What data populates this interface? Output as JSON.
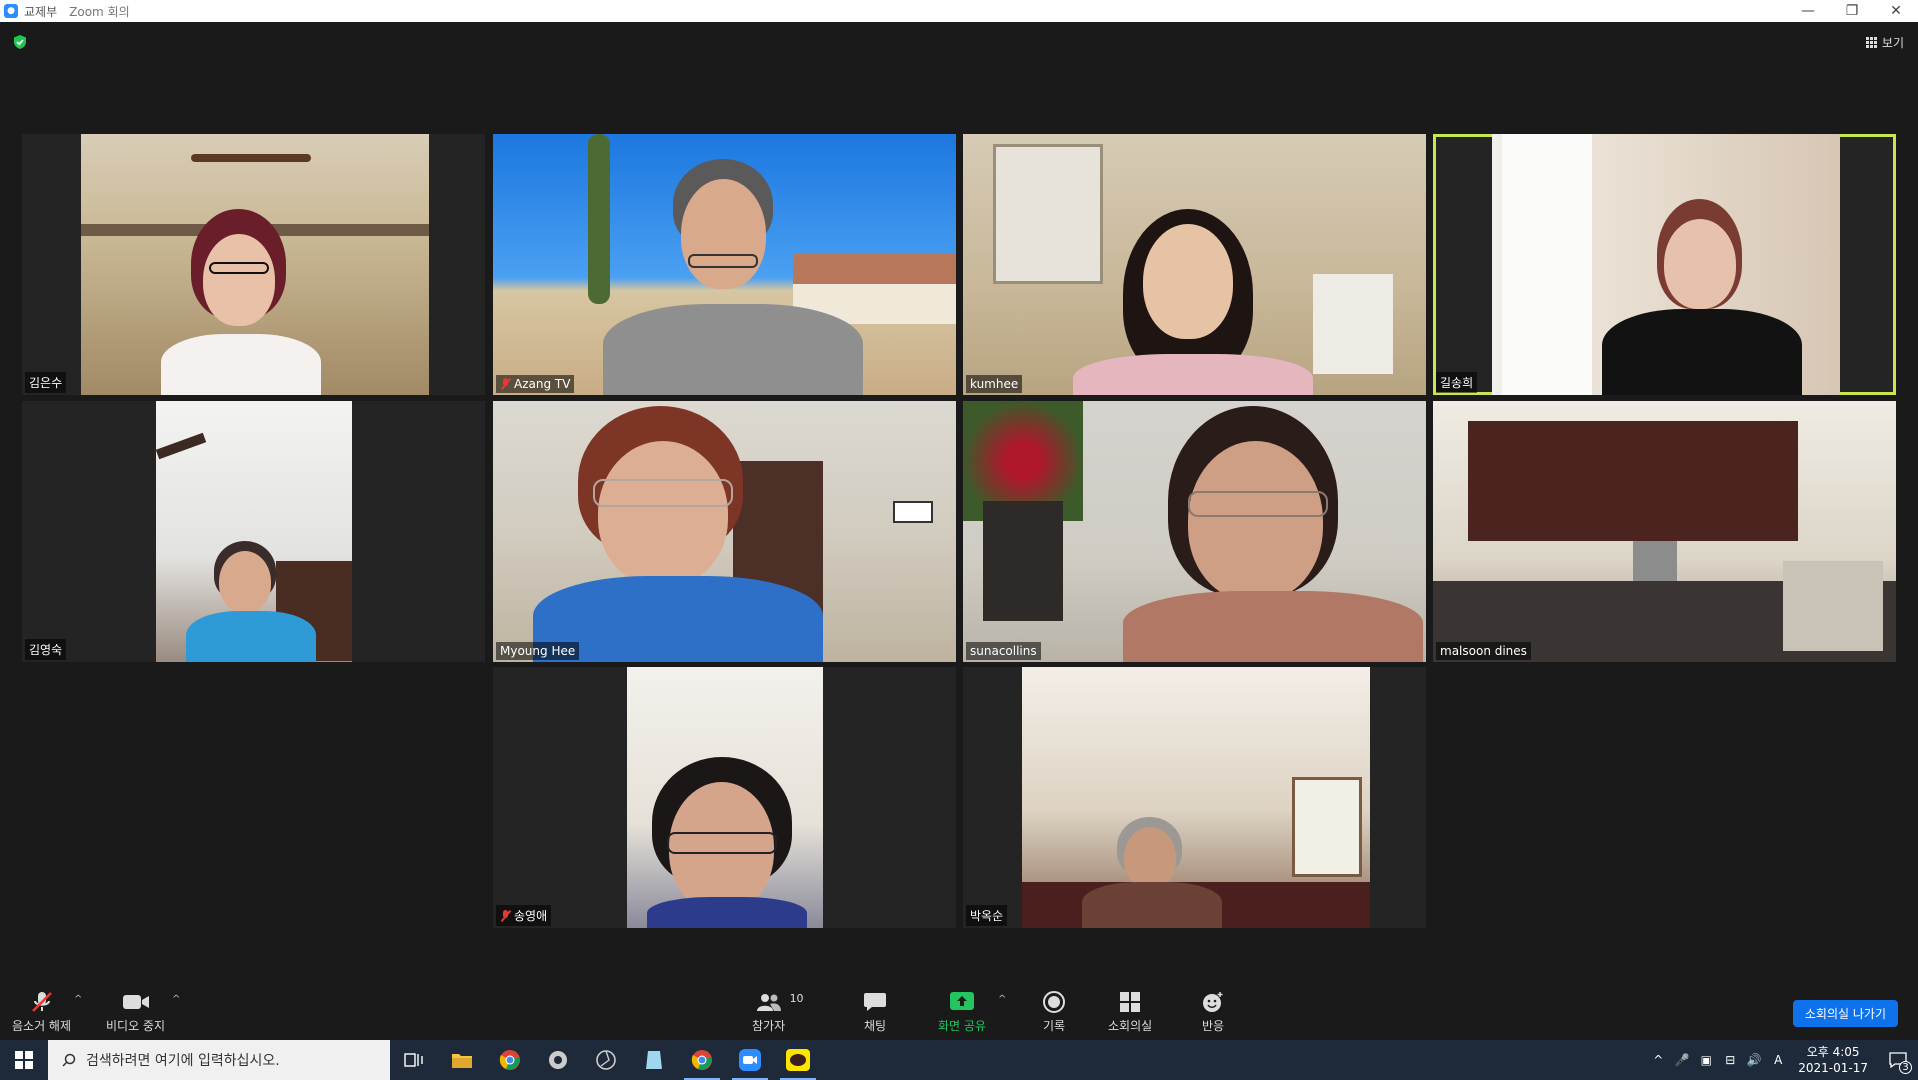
{
  "window": {
    "title": "교제부",
    "subtitle": "Zoom 회의"
  },
  "topbar": {
    "view_label": "보기"
  },
  "participants": [
    {
      "name": "김은수",
      "muted": false,
      "active": false
    },
    {
      "name": "Azang TV",
      "muted": true,
      "active": false
    },
    {
      "name": "kumhee",
      "muted": false,
      "active": false
    },
    {
      "name": "길송희",
      "muted": false,
      "active": true
    },
    {
      "name": "김영숙",
      "muted": false,
      "active": false
    },
    {
      "name": "Myoung Hee",
      "muted": false,
      "active": false
    },
    {
      "name": "sunacollins",
      "muted": false,
      "active": false
    },
    {
      "name": "malsoon dines",
      "muted": false,
      "active": false
    },
    {
      "name": "송영애",
      "muted": true,
      "active": false
    },
    {
      "name": "박옥순",
      "muted": false,
      "active": false
    }
  ],
  "toolbar": {
    "unmute_label": "음소거 해제",
    "video_label": "비디오 중지",
    "participants_label": "참가자",
    "participants_count": "10",
    "chat_label": "채팅",
    "share_label": "화면 공유",
    "record_label": "기록",
    "breakout_label": "소회의실",
    "reactions_label": "반응",
    "leave_label": "소회의실 나가기"
  },
  "taskbar": {
    "search_placeholder": "검색하려면 여기에 입력하십시오.",
    "time": "오후 4:05",
    "date": "2021-01-17",
    "ime": "A",
    "notifications": "3"
  },
  "colors": {
    "active_speaker": "#c8e650",
    "leave_button": "#0e72ed",
    "share_green": "#22c55e",
    "muted_red": "#e53935"
  }
}
